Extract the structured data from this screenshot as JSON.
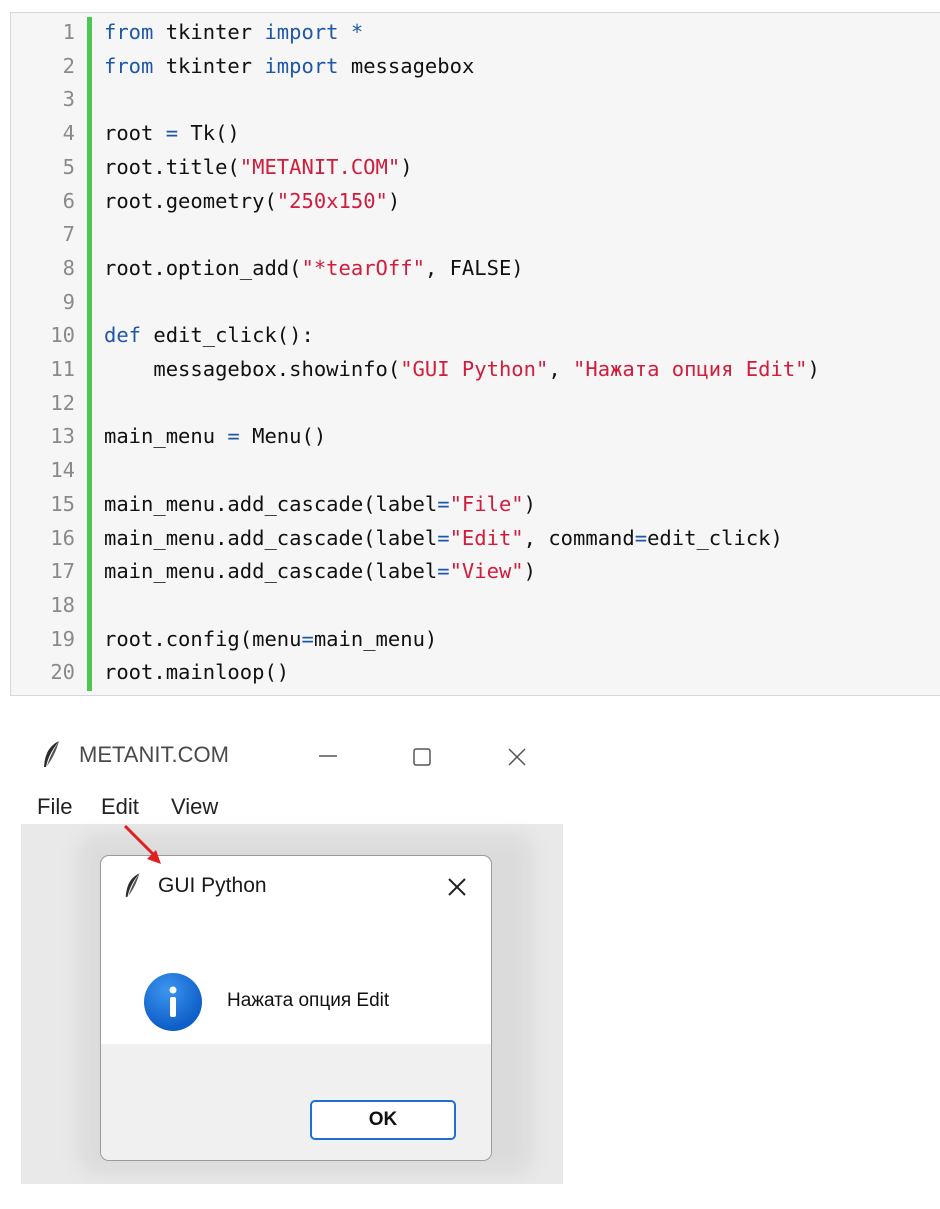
{
  "code": {
    "lines": [
      {
        "n": "1",
        "parts": [
          [
            "kw",
            "from"
          ],
          [
            "plain",
            " tkinter "
          ],
          [
            "kw",
            "import"
          ],
          [
            "plain",
            " "
          ],
          [
            "op",
            "*"
          ]
        ]
      },
      {
        "n": "2",
        "parts": [
          [
            "kw",
            "from"
          ],
          [
            "plain",
            " tkinter "
          ],
          [
            "kw",
            "import"
          ],
          [
            "plain",
            " messagebox"
          ]
        ]
      },
      {
        "n": "3",
        "parts": []
      },
      {
        "n": "4",
        "parts": [
          [
            "plain",
            "root "
          ],
          [
            "op",
            "="
          ],
          [
            "plain",
            " Tk()"
          ]
        ]
      },
      {
        "n": "5",
        "parts": [
          [
            "plain",
            "root.title("
          ],
          [
            "str",
            "\"METANIT.COM\""
          ],
          [
            "plain",
            ")"
          ]
        ]
      },
      {
        "n": "6",
        "parts": [
          [
            "plain",
            "root.geometry("
          ],
          [
            "str",
            "\"250x150\""
          ],
          [
            "plain",
            ")"
          ]
        ]
      },
      {
        "n": "7",
        "parts": []
      },
      {
        "n": "8",
        "parts": [
          [
            "plain",
            "root.option_add("
          ],
          [
            "str",
            "\"*tearOff\""
          ],
          [
            "plain",
            ", FALSE)"
          ]
        ]
      },
      {
        "n": "9",
        "parts": []
      },
      {
        "n": "10",
        "parts": [
          [
            "kw",
            "def"
          ],
          [
            "plain",
            " edit_click():"
          ]
        ]
      },
      {
        "n": "11",
        "parts": [
          [
            "plain",
            "    messagebox.showinfo("
          ],
          [
            "str",
            "\"GUI Python\""
          ],
          [
            "plain",
            ", "
          ],
          [
            "str",
            "\"Нажата опция Edit\""
          ],
          [
            "plain",
            ")"
          ]
        ]
      },
      {
        "n": "12",
        "parts": []
      },
      {
        "n": "13",
        "parts": [
          [
            "plain",
            "main_menu "
          ],
          [
            "op",
            "="
          ],
          [
            "plain",
            " Menu()"
          ]
        ]
      },
      {
        "n": "14",
        "parts": []
      },
      {
        "n": "15",
        "parts": [
          [
            "plain",
            "main_menu.add_cascade(label"
          ],
          [
            "op",
            "="
          ],
          [
            "str",
            "\"File\""
          ],
          [
            "plain",
            ")"
          ]
        ]
      },
      {
        "n": "16",
        "parts": [
          [
            "plain",
            "main_menu.add_cascade(label"
          ],
          [
            "op",
            "="
          ],
          [
            "str",
            "\"Edit\""
          ],
          [
            "plain",
            ", command"
          ],
          [
            "op",
            "="
          ],
          [
            "plain",
            "edit_click)"
          ]
        ]
      },
      {
        "n": "17",
        "parts": [
          [
            "plain",
            "main_menu.add_cascade(label"
          ],
          [
            "op",
            "="
          ],
          [
            "str",
            "\"View\""
          ],
          [
            "plain",
            ")"
          ]
        ]
      },
      {
        "n": "18",
        "parts": []
      },
      {
        "n": "19",
        "parts": [
          [
            "plain",
            "root.config(menu"
          ],
          [
            "op",
            "="
          ],
          [
            "plain",
            "main_menu)"
          ]
        ]
      },
      {
        "n": "20",
        "parts": [
          [
            "plain",
            "root.mainloop()"
          ]
        ]
      }
    ]
  },
  "window": {
    "title": "METANIT.COM",
    "icon": "feather-icon",
    "controls": [
      "minimize-icon",
      "maximize-icon",
      "close-icon"
    ],
    "menu": [
      "File",
      "Edit",
      "View"
    ]
  },
  "dialog": {
    "title": "GUI Python",
    "message": "Нажата опция Edit",
    "ok_label": "OK",
    "icon": "info-icon"
  },
  "colors": {
    "keyword": "#1f57a8",
    "string": "#d11c3c",
    "gutter_accent": "#4cc752",
    "arrow": "#e02020",
    "button_border": "#1e6fd0"
  }
}
